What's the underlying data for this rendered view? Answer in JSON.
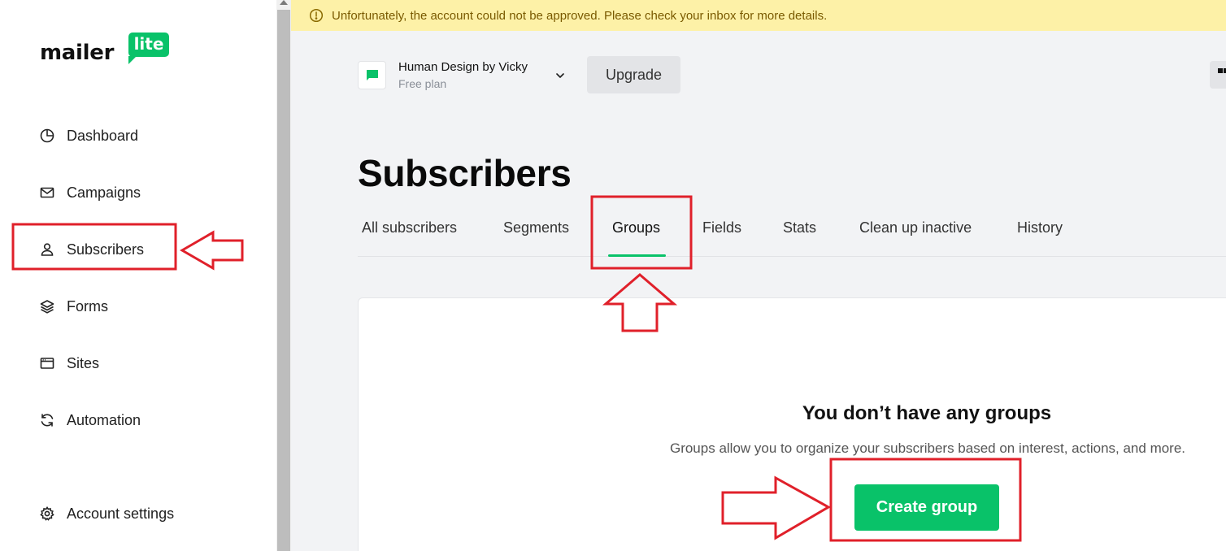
{
  "brand": {
    "word": "mailer",
    "badge": "lite",
    "accent_color": "#09c269"
  },
  "sidebar": {
    "items": [
      {
        "label": "Dashboard",
        "icon": "clock-pie-icon"
      },
      {
        "label": "Campaigns",
        "icon": "envelope-icon"
      },
      {
        "label": "Subscribers",
        "icon": "user-icon"
      },
      {
        "label": "Forms",
        "icon": "layers-icon"
      },
      {
        "label": "Sites",
        "icon": "browser-window-icon"
      },
      {
        "label": "Automation",
        "icon": "refresh-icon"
      },
      {
        "label": "Account settings",
        "icon": "gear-icon"
      }
    ]
  },
  "alert": {
    "text": "Unfortunately, the account could not be approved. Please check your inbox for more details.",
    "icon": "warning-circle-icon",
    "background": "#fdf1a7"
  },
  "account": {
    "name": "Human Design by Vicky",
    "plan": "Free plan"
  },
  "header": {
    "upgrade_label": "Upgrade"
  },
  "page": {
    "title": "Subscribers"
  },
  "tabs": [
    {
      "label": "All subscribers",
      "active": false
    },
    {
      "label": "Segments",
      "active": false
    },
    {
      "label": "Groups",
      "active": true
    },
    {
      "label": "Fields",
      "active": false
    },
    {
      "label": "Stats",
      "active": false
    },
    {
      "label": "Clean up inactive",
      "active": false
    },
    {
      "label": "History",
      "active": false
    }
  ],
  "empty_state": {
    "title": "You don’t have any groups",
    "description": "Groups allow you to organize your subscribers based on interest, actions, and more.",
    "button_label": "Create group"
  },
  "annotation_color": "#e0202a"
}
